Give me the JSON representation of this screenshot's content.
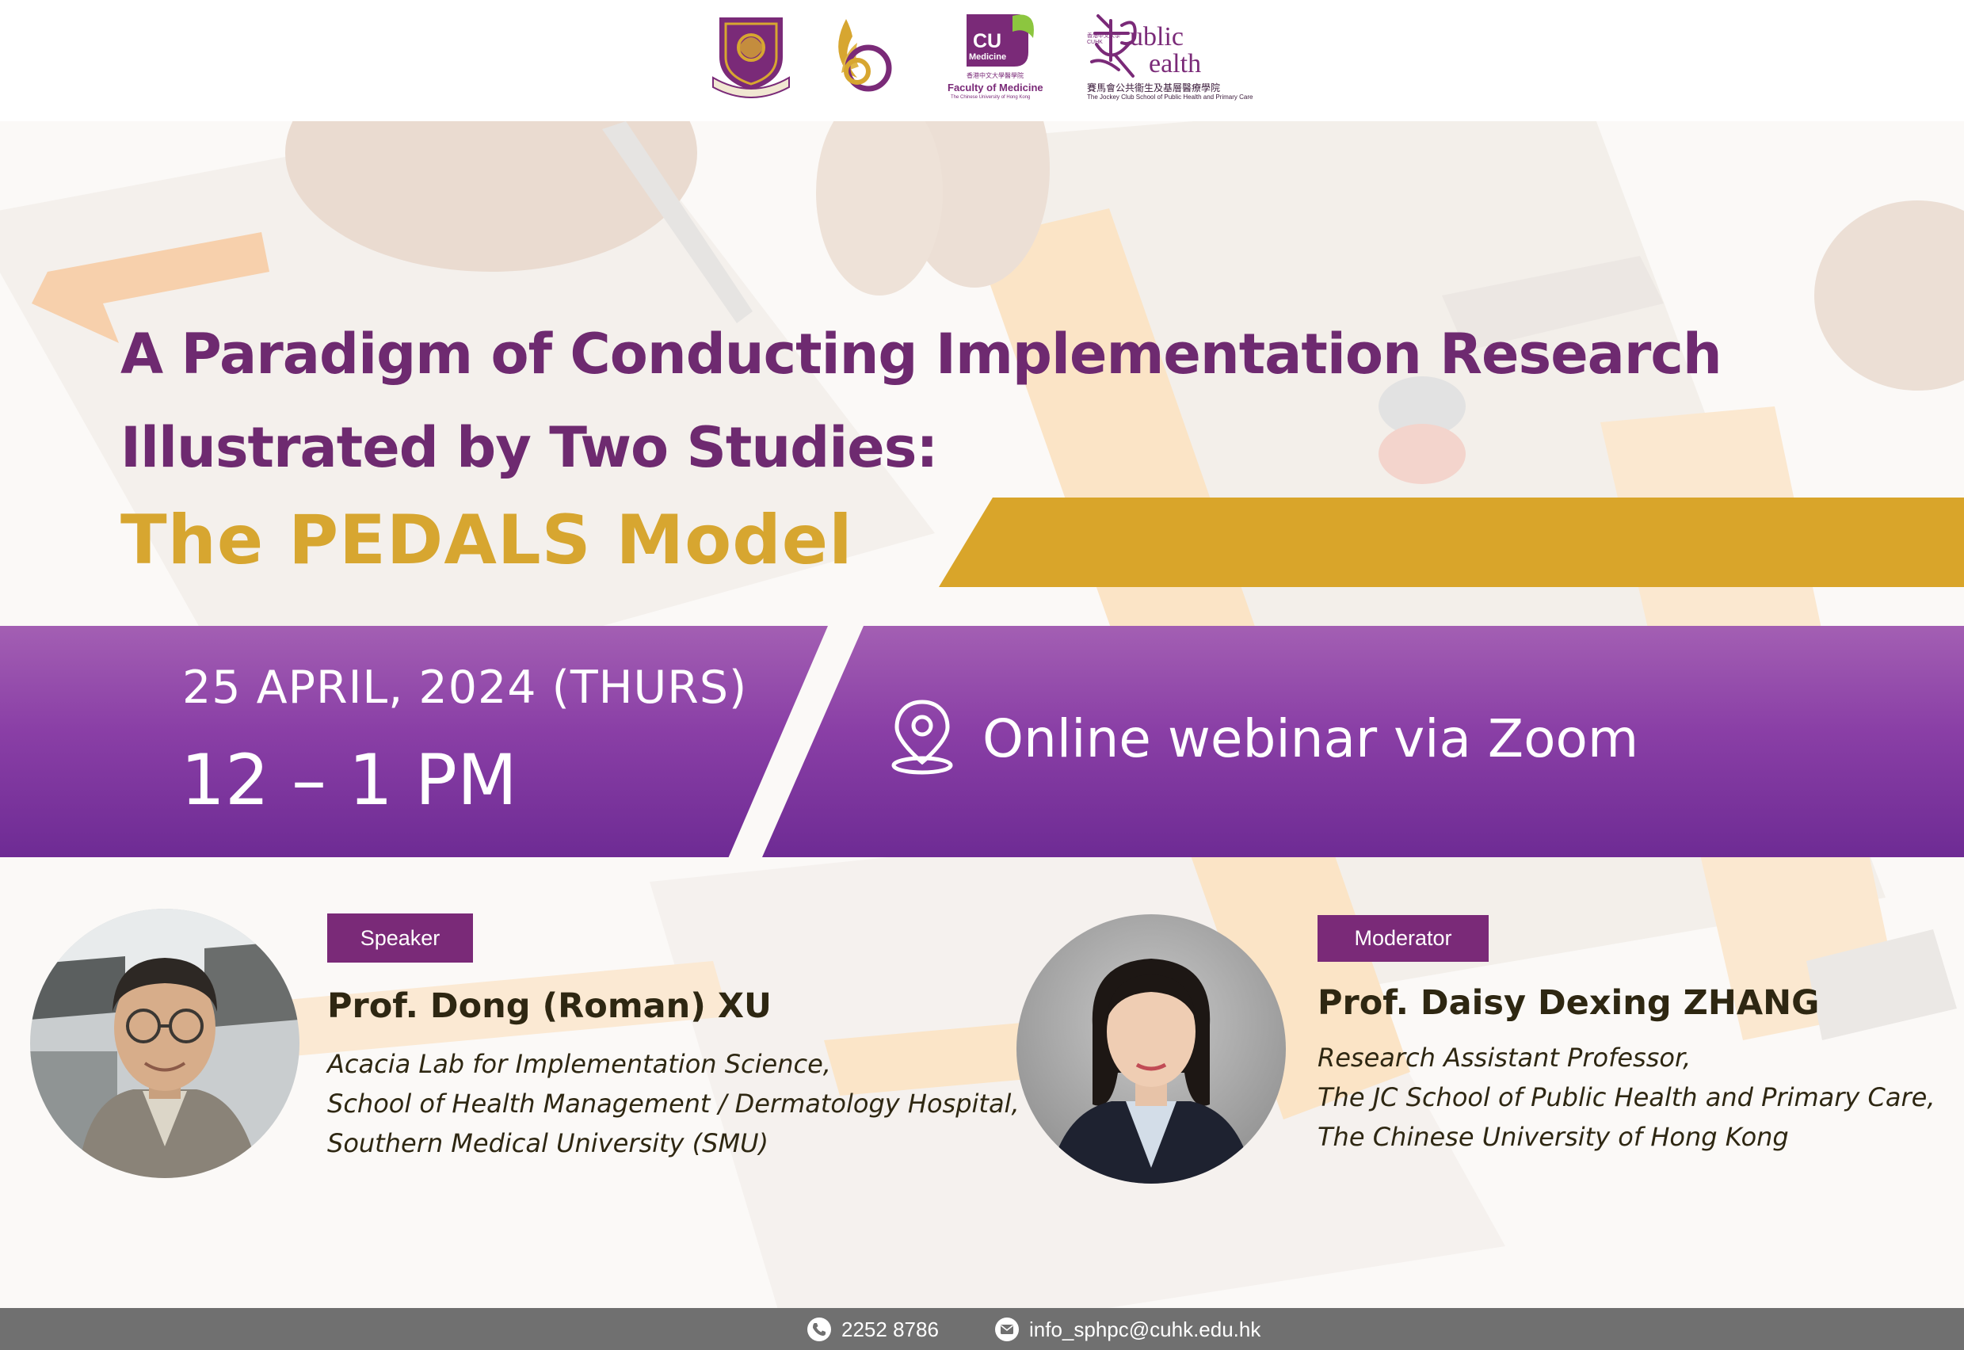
{
  "logos": {
    "cu_badge": "CU",
    "cu_medicine": "Medicine",
    "faculty_chinese": "香港中文大學醫學院",
    "faculty": "Faculty of Medicine",
    "faculty_university": "The Chinese University of Hong Kong",
    "ph_word_1": "ublic",
    "ph_word_2": "ealth",
    "ph_cuhk_chinese": "香港中文大學",
    "ph_cuhk": "CUHK",
    "ph_school_chinese": "賽馬會公共衞生及基層醫療學院",
    "ph_school": "The Jockey Club School of Public Health and Primary Care"
  },
  "event": {
    "title_line_1": "A Paradigm of Conducting Implementation Research",
    "title_line_2": "Illustrated by Two Studies:",
    "subtitle": "The PEDALS Model",
    "date": "25 APRIL, 2024 (THURS)",
    "time": "12 – 1 PM",
    "location": "Online webinar via Zoom"
  },
  "speaker": {
    "role": "Speaker",
    "name": "Prof. Dong (Roman) XU",
    "affiliation_1": "Acacia Lab for Implementation Science,",
    "affiliation_2": "School of Health Management / Dermatology Hospital,",
    "affiliation_3": "Southern Medical University (SMU)"
  },
  "moderator": {
    "role": "Moderator",
    "name": "Prof. Daisy Dexing ZHANG",
    "affiliation_1": "Research Assistant Professor,",
    "affiliation_2": "The JC School of Public Health and Primary Care,",
    "affiliation_3": "The Chinese University of Hong Kong"
  },
  "contact": {
    "phone_icon": "phone-icon",
    "phone": "2252 8786",
    "email_icon": "mail-icon",
    "email": "info_sphpc@cuhk.edu.hk"
  },
  "colors": {
    "title_purple": "#6e2a70",
    "gold": "#d9a52a",
    "banner_top": "#a35fb3",
    "banner_bottom": "#6e2b94",
    "tag_purple": "#7a2a78",
    "name_text": "#2e2712",
    "footer_grey": "#707070"
  }
}
